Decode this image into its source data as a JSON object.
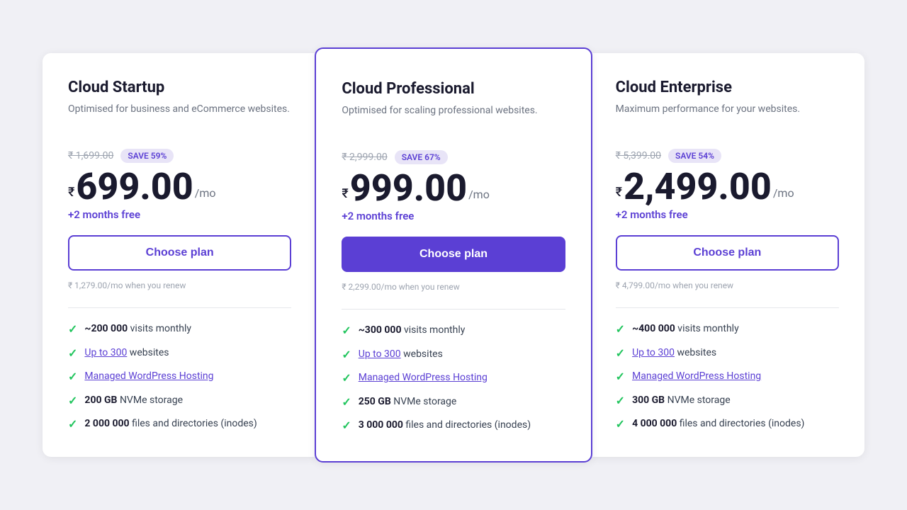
{
  "cards": [
    {
      "id": "startup",
      "name": "Cloud Startup",
      "description": "Optimised for business and eCommerce websites.",
      "original_price": "₹ 1,699.00",
      "save_label": "SAVE 59%",
      "currency": "₹",
      "price": "699.00",
      "period": "/mo",
      "months_free": "+2 months free",
      "choose_label": "Choose plan",
      "renew_text": "₹ 1,279.00/mo when you renew",
      "featured": false,
      "features": [
        {
          "text": "~200 000 visits monthly",
          "bold": "~200 000",
          "link": false
        },
        {
          "text": "Up to 300 websites",
          "bold": "Up to 300",
          "link": true
        },
        {
          "text": "Managed WordPress Hosting",
          "bold": "Managed WordPress Hosting",
          "link": true
        },
        {
          "text": "200 GB NVMe storage",
          "bold": "200 GB",
          "link": false
        },
        {
          "text": "2 000 000 files and directories (inodes)",
          "bold": "2 000 000",
          "link": false
        }
      ]
    },
    {
      "id": "professional",
      "name": "Cloud Professional",
      "description": "Optimised for scaling professional websites.",
      "original_price": "₹ 2,999.00",
      "save_label": "SAVE 67%",
      "currency": "₹",
      "price": "999.00",
      "period": "/mo",
      "months_free": "+2 months free",
      "choose_label": "Choose plan",
      "renew_text": "₹ 2,299.00/mo when you renew",
      "featured": true,
      "features": [
        {
          "text": "~300 000 visits monthly",
          "bold": "~300 000",
          "link": false
        },
        {
          "text": "Up to 300 websites",
          "bold": "Up to 300",
          "link": true
        },
        {
          "text": "Managed WordPress Hosting",
          "bold": "Managed WordPress Hosting",
          "link": true
        },
        {
          "text": "250 GB NVMe storage",
          "bold": "250 GB",
          "link": false
        },
        {
          "text": "3 000 000 files and directories (inodes)",
          "bold": "3 000 000",
          "link": false
        }
      ]
    },
    {
      "id": "enterprise",
      "name": "Cloud Enterprise",
      "description": "Maximum performance for your websites.",
      "original_price": "₹ 5,399.00",
      "save_label": "SAVE 54%",
      "currency": "₹",
      "price": "2,499.00",
      "period": "/mo",
      "months_free": "+2 months free",
      "choose_label": "Choose plan",
      "renew_text": "₹ 4,799.00/mo when you renew",
      "featured": false,
      "features": [
        {
          "text": "~400 000 visits monthly",
          "bold": "~400 000",
          "link": false
        },
        {
          "text": "Up to 300 websites",
          "bold": "Up to 300",
          "link": true
        },
        {
          "text": "Managed WordPress Hosting",
          "bold": "Managed WordPress Hosting",
          "link": true
        },
        {
          "text": "300 GB NVMe storage",
          "bold": "300 GB",
          "link": false
        },
        {
          "text": "4 000 000 files and directories (inodes)",
          "bold": "4 000 000",
          "link": false
        }
      ]
    }
  ]
}
